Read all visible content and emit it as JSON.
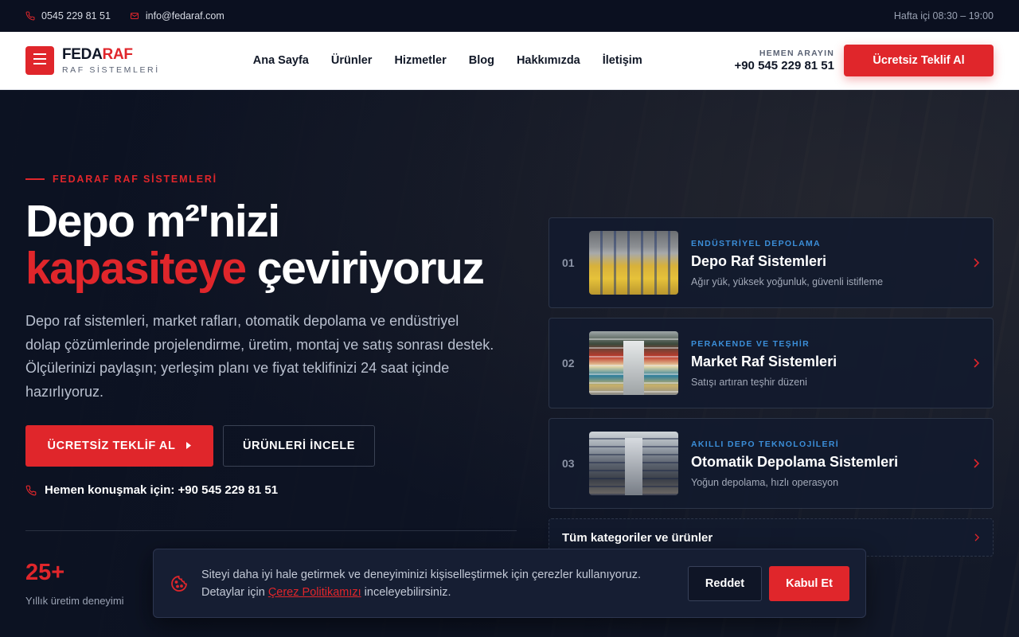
{
  "topbar": {
    "phone": "0545 229 81 51",
    "email": "info@fedaraf.com",
    "hours": "Hafta içi 08:30 – 19:00"
  },
  "header": {
    "logo_main": "FEDA",
    "logo_accent": "RAF",
    "logo_sub": "RAF SİSTEMLERİ",
    "nav": [
      "Ana Sayfa",
      "Ürünler",
      "Hizmetler",
      "Blog",
      "Hakkımızda",
      "İletişim"
    ],
    "call_label": "HEMEN ARAYIN",
    "call_number": "+90 545 229 81 51",
    "cta_label": "Ücretsiz Teklif Al"
  },
  "hero": {
    "eyebrow": "FEDARAF RAF SİSTEMLERİ",
    "title_line1": "Depo m²'nizi",
    "title_accent": "kapasiteye",
    "title_rest": " çeviriyoruz",
    "lead": "Depo raf sistemleri, market rafları, otomatik depolama ve endüstriyel dolap çözümlerinde projelendirme, üretim, montaj ve satış sonrası destek. Ölçülerinizi paylaşın; yerleşim planı ve fiyat teklifinizi 24 saat içinde hazırlıyoruz.",
    "primary_cta": "ÜCRETSİZ TEKLİF AL",
    "secondary_cta": "ÜRÜNLERİ İNCELE",
    "call_text": "Hemen konuşmak için: +90 545 229 81 51",
    "stat_value": "25+",
    "stat_label": "Yıllık üretim deneyimi"
  },
  "categories": [
    {
      "index": "01",
      "kicker": "ENDÜSTRİYEL DEPOLAMA",
      "title": "Depo Raf Sistemleri",
      "desc": "Ağır yük, yüksek yoğunluk, güvenli istifleme"
    },
    {
      "index": "02",
      "kicker": "PERAKENDE VE TEŞHİR",
      "title": "Market Raf Sistemleri",
      "desc": "Satışı artıran teşhir düzeni"
    },
    {
      "index": "03",
      "kicker": "AKILLI DEPO TEKNOLOJİLERİ",
      "title": "Otomatik Depolama Sistemleri",
      "desc": "Yoğun depolama, hızlı operasyon"
    }
  ],
  "all_categories": "Tüm kategoriler ve ürünler",
  "cookie": {
    "text_before": "Siteyi daha iyi hale getirmek ve deneyiminizi kişiselleştirmek için çerezler kullanıyoruz. Detaylar için ",
    "link": "Çerez Politikamızı",
    "text_after": " inceleyebilirsiniz.",
    "reject": "Reddet",
    "accept": "Kabul Et"
  },
  "colors": {
    "accent": "#e0262b",
    "dark": "#0c1222",
    "kicker": "#3b8ed8"
  },
  "icons": [
    "phone-icon",
    "mail-icon",
    "menu-icon",
    "chevron-right-icon",
    "cookie-icon"
  ]
}
